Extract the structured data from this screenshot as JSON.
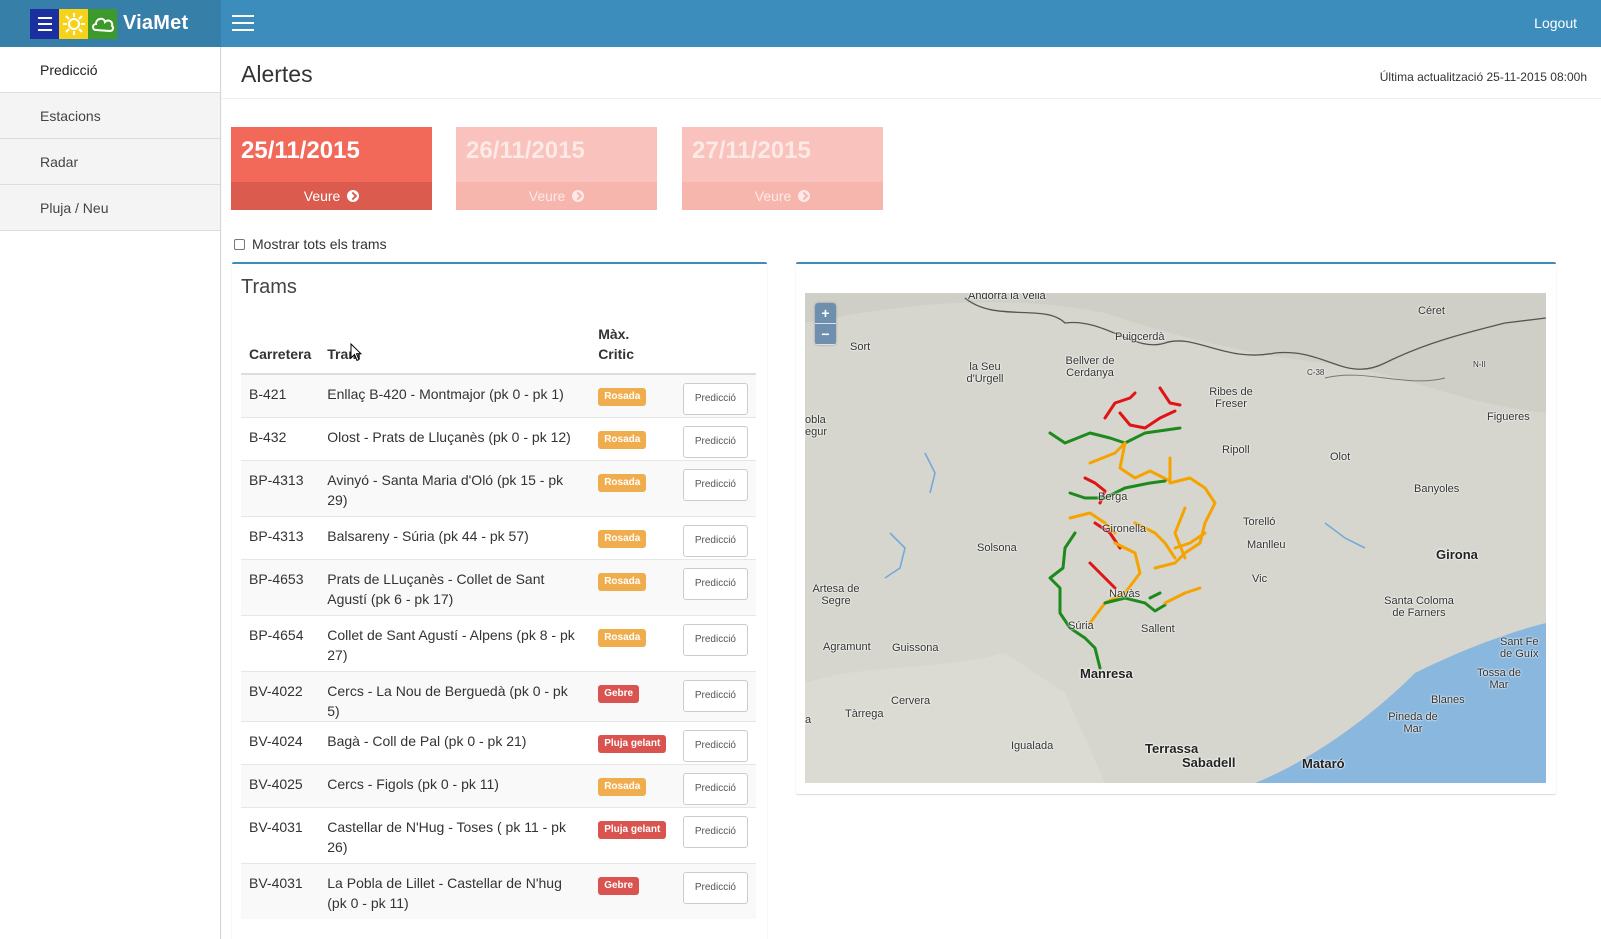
{
  "app": {
    "name": "ViaMet",
    "logout": "Logout"
  },
  "sidebar": {
    "items": [
      {
        "label": "Predicció"
      },
      {
        "label": "Estacions"
      },
      {
        "label": "Radar"
      },
      {
        "label": "Pluja / Neu"
      }
    ]
  },
  "page": {
    "title": "Alertes",
    "updated": "Última actualització 25-11-2015 08:00h"
  },
  "days": [
    {
      "date": "25/11/2015",
      "action": "Veure",
      "active": true
    },
    {
      "date": "26/11/2015",
      "action": "Veure",
      "active": false
    },
    {
      "date": "27/11/2015",
      "action": "Veure",
      "active": false
    }
  ],
  "filter": {
    "show_all_label": "Mostrar tots els trams",
    "checked": false
  },
  "trams": {
    "title": "Trams",
    "columns": {
      "road": "Carretera",
      "section": "Tram",
      "max_line1": "Màx.",
      "max_line2": "Critic"
    },
    "button_label": "Predicció",
    "rows": [
      {
        "road": "B-421",
        "section": "Enllaç B-420 - Montmajor (pk 0 - pk 1)",
        "level": "Rosada",
        "severity": "warn"
      },
      {
        "road": "B-432",
        "section": "Olost - Prats de Lluçanès (pk 0 - pk 12)",
        "level": "Rosada",
        "severity": "warn"
      },
      {
        "road": "BP-4313",
        "section": "Avinyó - Santa Maria d'Oló (pk 15 - pk 29)",
        "level": "Rosada",
        "severity": "warn"
      },
      {
        "road": "BP-4313",
        "section": "Balsareny - Súria (pk 44 - pk 57)",
        "level": "Rosada",
        "severity": "warn"
      },
      {
        "road": "BP-4653",
        "section": "Prats de LLuçanès - Collet de Sant Agustí (pk 6 - pk 17)",
        "level": "Rosada",
        "severity": "warn"
      },
      {
        "road": "BP-4654",
        "section": "Collet de Sant Agustí - Alpens (pk 8 - pk 27)",
        "level": "Rosada",
        "severity": "warn"
      },
      {
        "road": "BV-4022",
        "section": "Cercs - La Nou de Berguedà (pk 0 - pk 5)",
        "level": "Gebre",
        "severity": "danger"
      },
      {
        "road": "BV-4024",
        "section": "Bagà - Coll de Pal (pk 0 - pk 21)",
        "level": "Pluja gelant",
        "severity": "danger"
      },
      {
        "road": "BV-4025",
        "section": "Cercs - Figols (pk 0 - pk 11)",
        "level": "Rosada",
        "severity": "warn"
      },
      {
        "road": "BV-4031",
        "section": "Castellar de N'Hug - Toses ( pk 11 - pk 26)",
        "level": "Pluja gelant",
        "severity": "danger"
      },
      {
        "road": "BV-4031",
        "section": "La Pobla de Lillet - Castellar de N'hug (pk 0 - pk 11)",
        "level": "Gebre",
        "severity": "danger"
      }
    ]
  },
  "map": {
    "zoom_in": "+",
    "zoom_out": "−",
    "places": [
      "Andorra la Vella",
      "Céret",
      "Sort",
      "Puigcerdà",
      "la Seu d'Urgell",
      "Bellver de Cerdanya",
      "C-38",
      "N-II",
      "Ribes de Freser",
      "Figueres",
      "obla egur",
      "Ripoll",
      "Olot",
      "Banyoles",
      "Berga",
      "Torelló",
      "Gironella",
      "Solsona",
      "Manlleu",
      "Girona",
      "Vic",
      "Artesa de Segre",
      "Navàs",
      "Santa Coloma de Farners",
      "Súria",
      "Sallent",
      "Agramunt",
      "Guissona",
      "Sant Fe de Guíx",
      "Manresa",
      "Tossa de Mar",
      "Cervera",
      "Blanes",
      "Tàrrega",
      "a",
      "Pineda de Mar",
      "Igualada",
      "Terrassa",
      "Sabadell",
      "Mataró"
    ]
  }
}
